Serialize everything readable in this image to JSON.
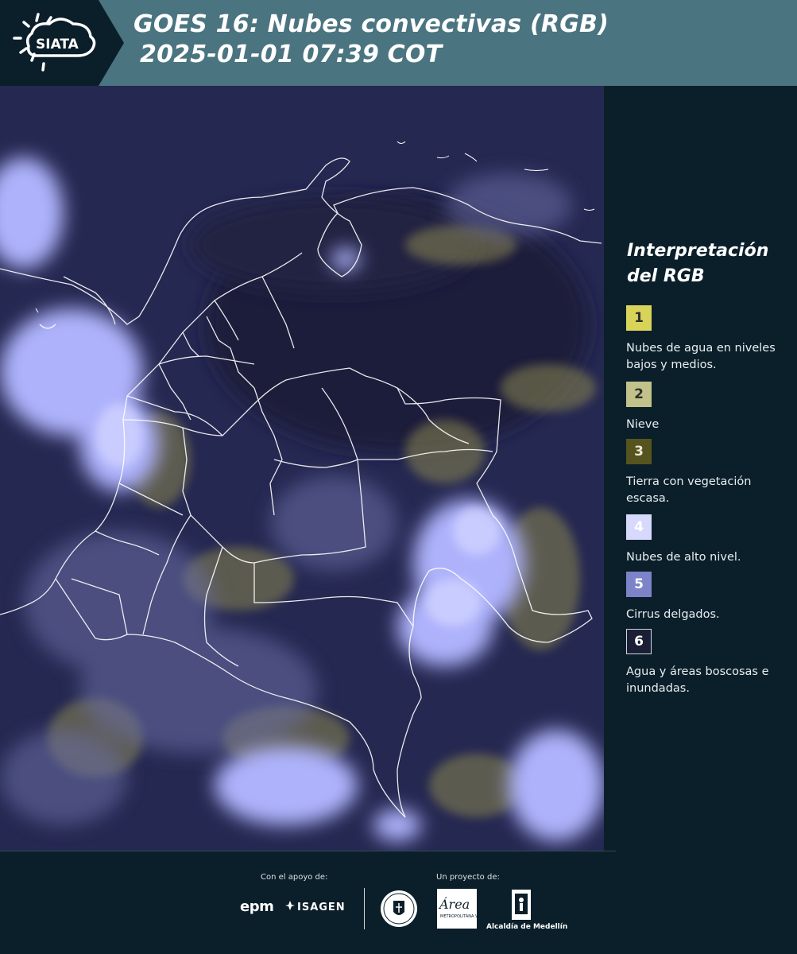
{
  "header": {
    "logo_text": "SIATA",
    "title_line1": "GOES 16: Nubes convectivas (RGB)",
    "title_line2": "2025-01-01 07:39 COT",
    "bg_color": "#4a7480"
  },
  "map": {
    "description_icon": "satellite-rgb-map",
    "colors": {
      "base": "#262a55",
      "cloud_high": "#b4b8ff",
      "cloud_low": "#c8c27a",
      "border": "#ffffff"
    }
  },
  "legend": {
    "title": "Interpretación del RGB",
    "items": [
      {
        "number": "1",
        "color": "#d8d45a",
        "label": "Nubes de agua en niveles bajos y medios."
      },
      {
        "number": "2",
        "color": "#c2c18a",
        "label": "Nieve"
      },
      {
        "number": "3",
        "color": "#56541e",
        "label": "Tierra con vegetación escasa."
      },
      {
        "number": "4",
        "color": "#d6d9fb",
        "label": "Nubes de alto nivel."
      },
      {
        "number": "5",
        "color": "#7c83c8",
        "label": "Cirrus delgados."
      },
      {
        "number": "6",
        "color": "#1b1f35",
        "label": "Agua y áreas boscosas e inundadas."
      }
    ]
  },
  "footer": {
    "support_label": "Con el apoyo de:",
    "project_label": "Un proyecto de:",
    "sponsors": [
      "epm",
      "ISAGEN"
    ],
    "area_logo_text": "Área",
    "area_logo_sub": "METROPOLITANA Valle de Aburrá",
    "alcaldia": "Alcaldía de Medellín"
  }
}
